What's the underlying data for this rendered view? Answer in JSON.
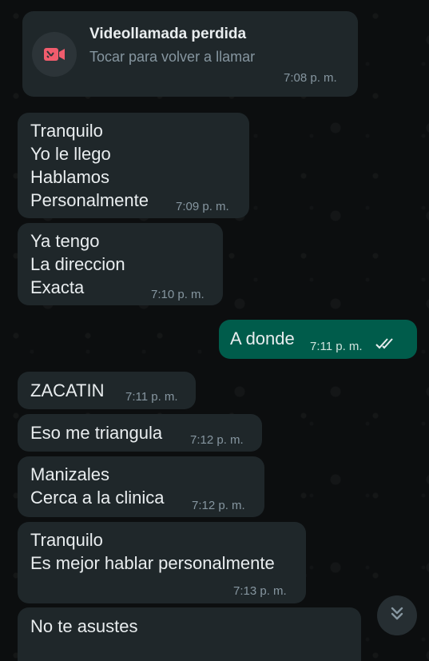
{
  "missed_call": {
    "title": "Videollamada perdida",
    "subtitle": "Tocar para volver a llamar",
    "time": "7:08 p. m.",
    "icon": "video-missed-icon"
  },
  "messages": [
    {
      "direction": "in",
      "text": "Tranquilo\nYo le llego\nHablamos\nPersonalmente",
      "time": "7:09 p. m."
    },
    {
      "direction": "in",
      "text": "Ya tengo\nLa direccion\nExacta",
      "time": "7:10 p. m."
    },
    {
      "direction": "out",
      "text": "A donde",
      "time": "7:11 p. m.",
      "status": "read"
    },
    {
      "direction": "in",
      "text": "ZACATIN",
      "time": "7:11 p. m."
    },
    {
      "direction": "in",
      "text": "Eso me triangula",
      "time": "7:12 p. m."
    },
    {
      "direction": "in",
      "text": "Manizales\nCerca a la clinica",
      "time": "7:12 p. m."
    },
    {
      "direction": "in",
      "text": "Tranquilo\nEs mejor hablar personalmente",
      "time": "7:13 p. m."
    },
    {
      "direction": "in",
      "text": "No te asustes",
      "time": ""
    }
  ],
  "scroll_down_icon": "double-chevron-down-icon",
  "colors": {
    "incoming_bubble": "#1f272a",
    "outgoing_bubble": "#005c4b",
    "read_ticks": "#e9edef",
    "missed_icon": "#f15c6d",
    "background": "#0c0e0f"
  }
}
